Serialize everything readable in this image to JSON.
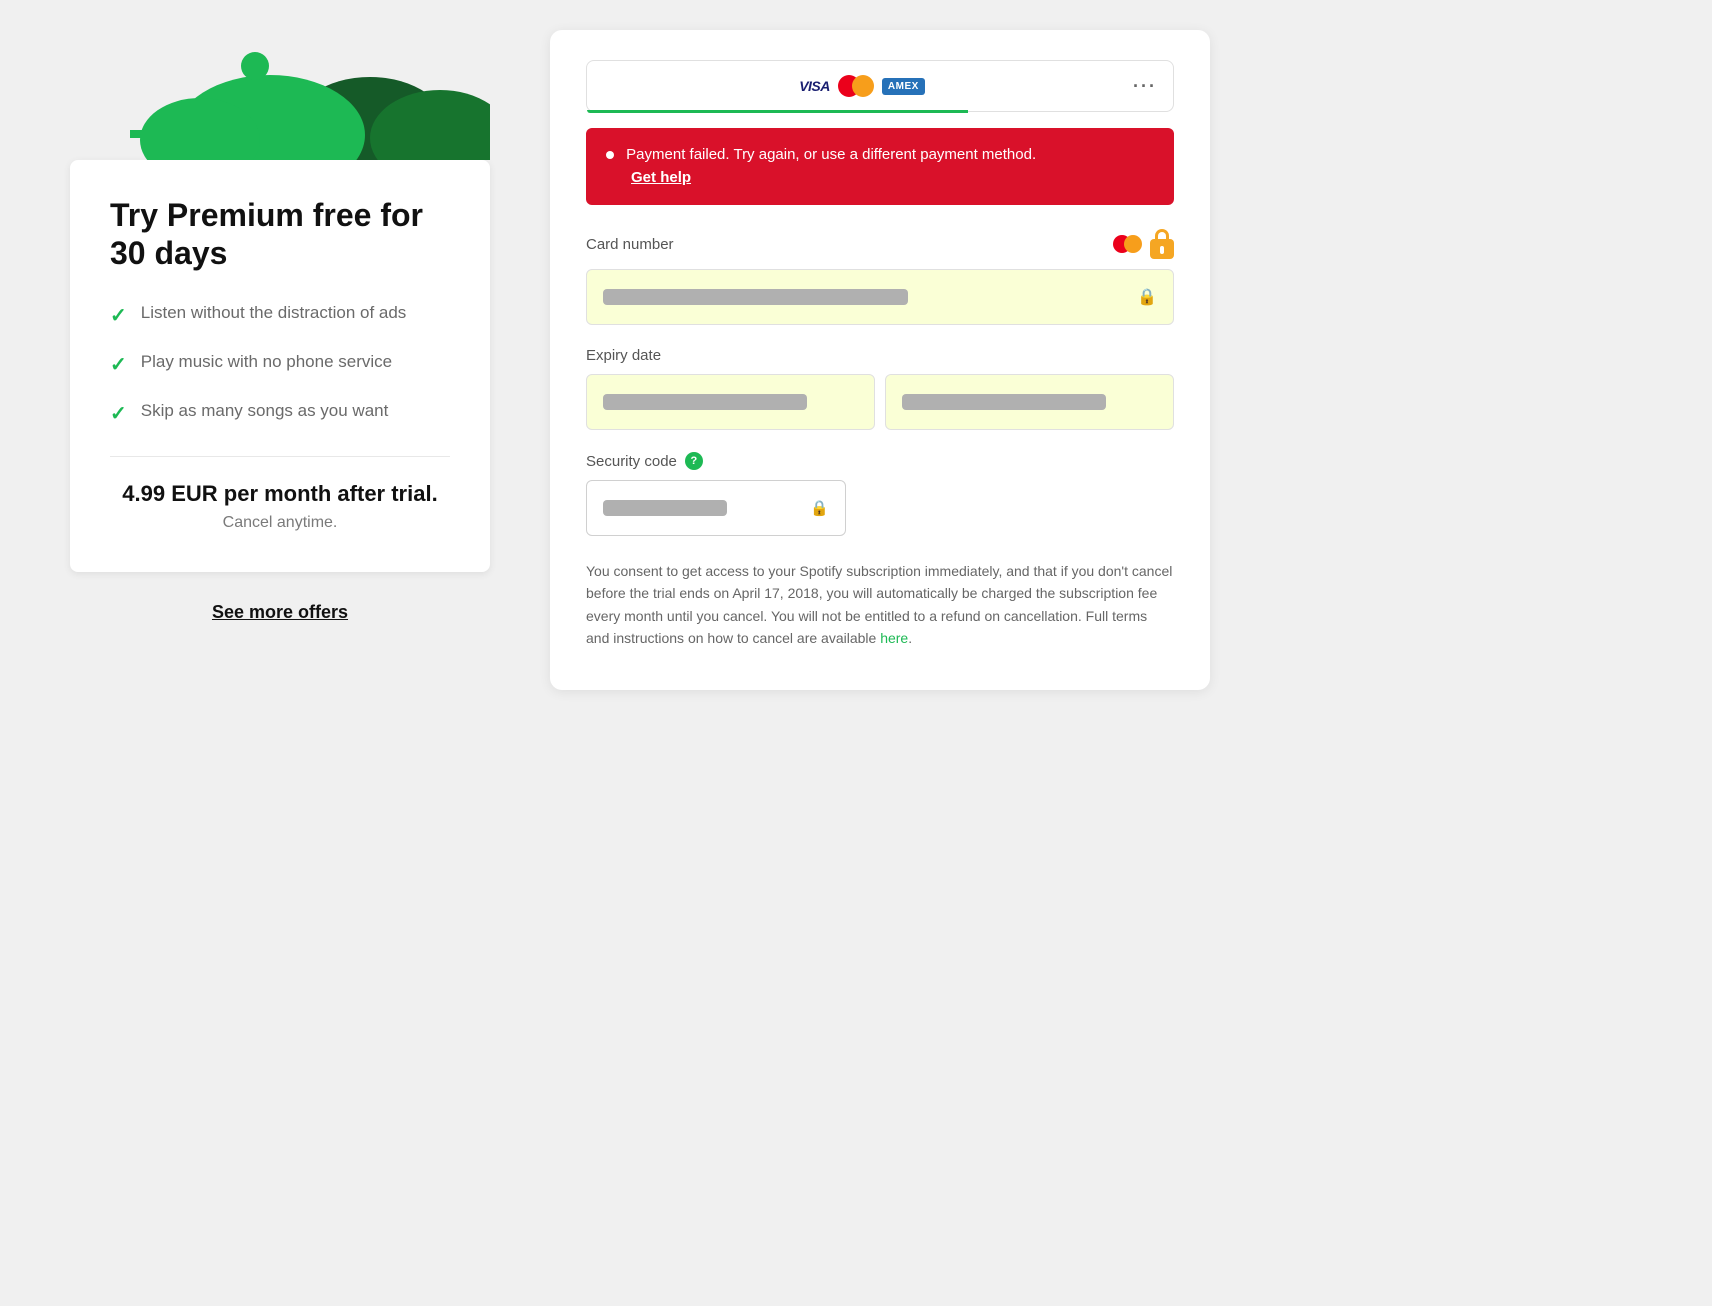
{
  "left": {
    "offer_title": "Try Premium free for 30 days",
    "features": [
      {
        "text": "Listen without the distraction of ads"
      },
      {
        "text": "Play music with no phone service"
      },
      {
        "text": "Skip as many songs as you want"
      }
    ],
    "price_text": "4.99 EUR per month after trial.",
    "cancel_text": "Cancel anytime.",
    "see_more_label": "See more offers"
  },
  "right": {
    "payment_method": {
      "more_label": "···"
    },
    "error": {
      "message": "Payment failed. Try again, or use a different payment method.",
      "link_text": "Get help"
    },
    "card_number_label": "Card number",
    "expiry_label": "Expiry date",
    "security_label": "Security code",
    "consent_text": "You consent to get access to your Spotify subscription immediately, and that if you don't cancel before the trial ends on April 17, 2018, you will automatically be charged the subscription fee every month until you cancel. You will not be entitled to a refund on cancellation. Full terms and instructions on how to cancel are available",
    "consent_link_text": "here"
  }
}
